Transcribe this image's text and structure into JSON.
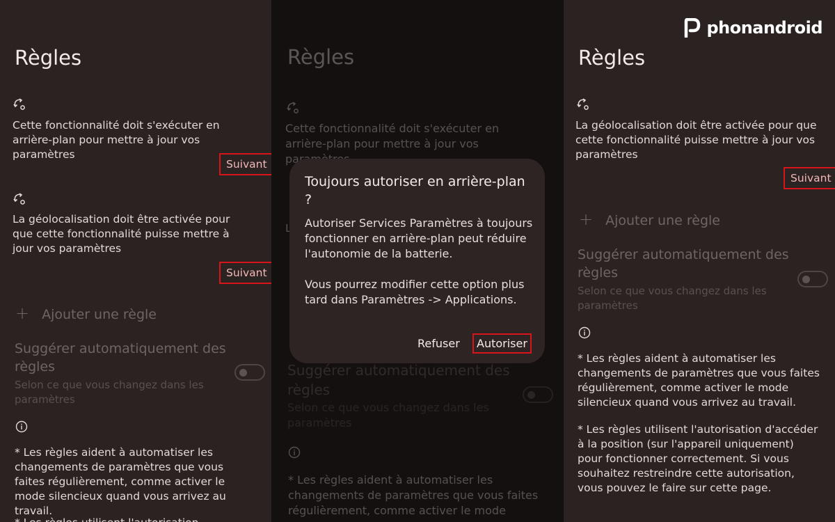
{
  "brand": {
    "name": "phonandroid"
  },
  "panel1": {
    "title": "Règles",
    "rule1_text": "Cette fonctionnalité doit s'exécuter en arrière-plan pour mettre à jour vos paramètres",
    "rule1_button": "Suivant",
    "rule2_text": "La géolocalisation doit être activée pour que cette fonctionnalité puisse mettre à jour vos paramètres",
    "rule2_button": "Suivant",
    "add_rule": "Ajouter une règle",
    "suggest_title": "Suggérer automatiquement des règles",
    "suggest_sub": "Selon ce que vous changez dans les paramètres",
    "note1": "* Les règles aident à automatiser les changements de paramètres que vous faites régulièrement, comme activer le mode silencieux quand vous arrivez au travail.",
    "note2": "* Les règles utilisent l'autorisation d'accéder"
  },
  "panel2": {
    "title": "Règles",
    "rule1_text": "Cette fonctionnalité doit s'exécuter en arrière-plan pour mettre à jour vos paramètres",
    "rule2_partial": "L",
    "suggest_title": "Suggérer automatiquement des règles",
    "suggest_sub": "Selon ce que vous changez dans les paramètres",
    "note1": "* Les règles aident à automatiser les changements de paramètres que vous faites régulièrement, comme activer le mode",
    "dialog": {
      "title": "Toujours autoriser en arrière-plan ?",
      "body1": "Autoriser Services Paramètres à toujours fonctionner en arrière-plan peut réduire l'autonomie de la batterie.",
      "body2": "Vous pourrez modifier cette option plus tard dans Paramètres -> Applications.",
      "refuse": "Refuser",
      "allow": "Autoriser"
    }
  },
  "panel3": {
    "title": "Règles",
    "rule_text": "La géolocalisation doit être activée pour que cette fonctionnalité puisse mettre à jour vos paramètres",
    "rule_button": "Suivant",
    "add_rule": "Ajouter une règle",
    "suggest_title": "Suggérer automatiquement des règles",
    "suggest_sub": "Selon ce que vous changez dans les paramètres",
    "note1": "* Les règles aident à automatiser les changements de paramètres que vous faites régulièrement, comme activer le mode silencieux quand vous arrivez au travail.",
    "note2": "* Les règles utilisent l'autorisation d'accéder à la position (sur l'appareil uniquement) pour fonctionner correctement. Si vous souhaitez restreindre cette autorisation, vous pouvez le faire sur cette page."
  },
  "icons": {
    "rule": "rule-sync-icon",
    "info": "info-icon",
    "add": "plus-icon"
  },
  "colors": {
    "highlight_box": "#d9151b",
    "suivant_text": "#f3b7b7",
    "background": "#2b2222"
  }
}
